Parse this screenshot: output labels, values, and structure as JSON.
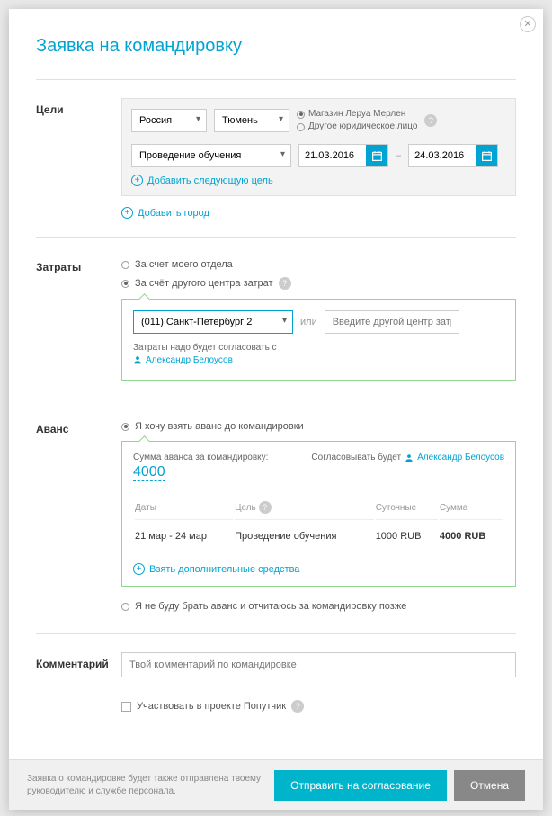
{
  "modal": {
    "title": "Заявка на командировку"
  },
  "goals": {
    "label": "Цели",
    "country": "Россия",
    "city": "Тюмень",
    "org_type": {
      "option1": "Магазин Леруа Мерлен",
      "option2": "Другое юридическое лицо"
    },
    "purpose": "Проведение обучения",
    "date_from": "21.03.2016",
    "date_to": "24.03.2016",
    "add_goal": "Добавить следующую цель",
    "add_city": "Добавить город"
  },
  "costs": {
    "label": "Затраты",
    "option1": "За счет моего отдела",
    "option2": "За счёт другого центра затрат",
    "center": "(011) Санкт-Петербург 2",
    "or": "или",
    "placeholder": "Введите другой центр затрат",
    "agree_text": "Затраты надо будет согласовать с",
    "approver": "Александр Белоусов"
  },
  "advance": {
    "label": "Аванс",
    "option1": "Я хочу взять аванс до командировки",
    "amount_label": "Сумма аванса за командировку:",
    "amount": "4000",
    "approver_label": "Согласовывать будет",
    "approver": "Александр Белоусов",
    "th_dates": "Даты",
    "th_goal": "Цель",
    "th_perdiem": "Суточные",
    "th_sum": "Сумма",
    "row_dates": "21 мар - 24 мар",
    "row_goal": "Проведение обучения",
    "row_perdiem": "1000 RUB",
    "row_sum": "4000 RUB",
    "add_funds": "Взять дополнительные средства",
    "option2": "Я не буду брать аванс и отчитаюсь за командировку позже"
  },
  "comment": {
    "label": "Комментарий",
    "placeholder": "Твой комментарий по командировке"
  },
  "companion": {
    "label": "Участвовать в проекте Попутчик"
  },
  "footer": {
    "note": "Заявка о командировке будет также отправлена твоему руководителю и службе персонала.",
    "submit": "Отправить на согласование",
    "cancel": "Отмена"
  }
}
